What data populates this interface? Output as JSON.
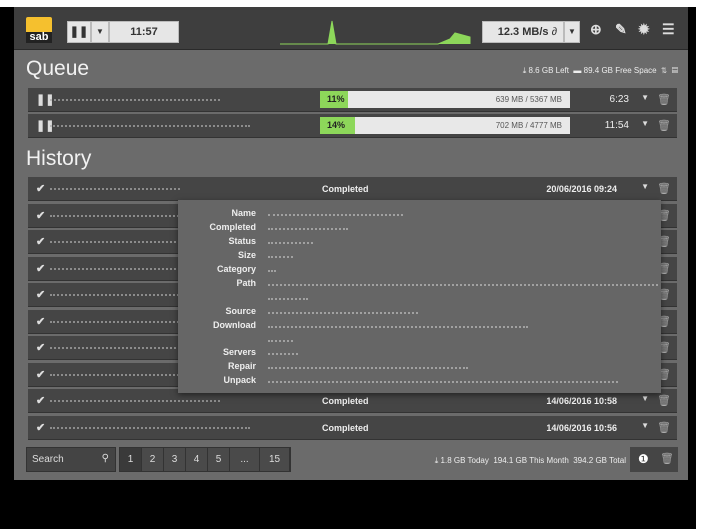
{
  "header": {
    "logo": "sab",
    "pause_icon": "pause-icon",
    "timer": "11:57",
    "speed": "12.3 MB/s",
    "speed_icon": "link-icon",
    "accent": "#8dd75a"
  },
  "queue": {
    "title": "Queue",
    "left": "8.6 GB Left",
    "free_space": "89.4 GB Free Space",
    "items": [
      {
        "percent": "11%",
        "progress": 0.11,
        "size": "639 MB / 5367 MB",
        "eta": "6:23"
      },
      {
        "percent": "14%",
        "progress": 0.14,
        "size": "702 MB / 4777 MB",
        "eta": "11:54"
      }
    ]
  },
  "history": {
    "title": "History",
    "items": [
      {
        "status": "Completed",
        "date": "20/06/2016 09:24"
      },
      {
        "status": "",
        "date": ""
      },
      {
        "status": "",
        "date": ""
      },
      {
        "status": "",
        "date": ""
      },
      {
        "status": "",
        "date": ""
      },
      {
        "status": "",
        "date": ""
      },
      {
        "status": "",
        "date": ""
      },
      {
        "status": "",
        "date": ""
      },
      {
        "status": "Completed",
        "date": "14/06/2016 10:58"
      },
      {
        "status": "Completed",
        "date": "14/06/2016 10:56"
      }
    ],
    "details_labels": [
      "Name",
      "Completed",
      "Status",
      "Size",
      "Category",
      "Path",
      "Source",
      "Download",
      "Servers",
      "Repair",
      "Unpack"
    ]
  },
  "footer": {
    "search_placeholder": "Search",
    "pages": [
      "1",
      "2",
      "3",
      "4",
      "5",
      "...",
      "15"
    ],
    "today": "1.8 GB Today",
    "month": "194.1 GB This Month",
    "total": "394.2 GB Total"
  }
}
